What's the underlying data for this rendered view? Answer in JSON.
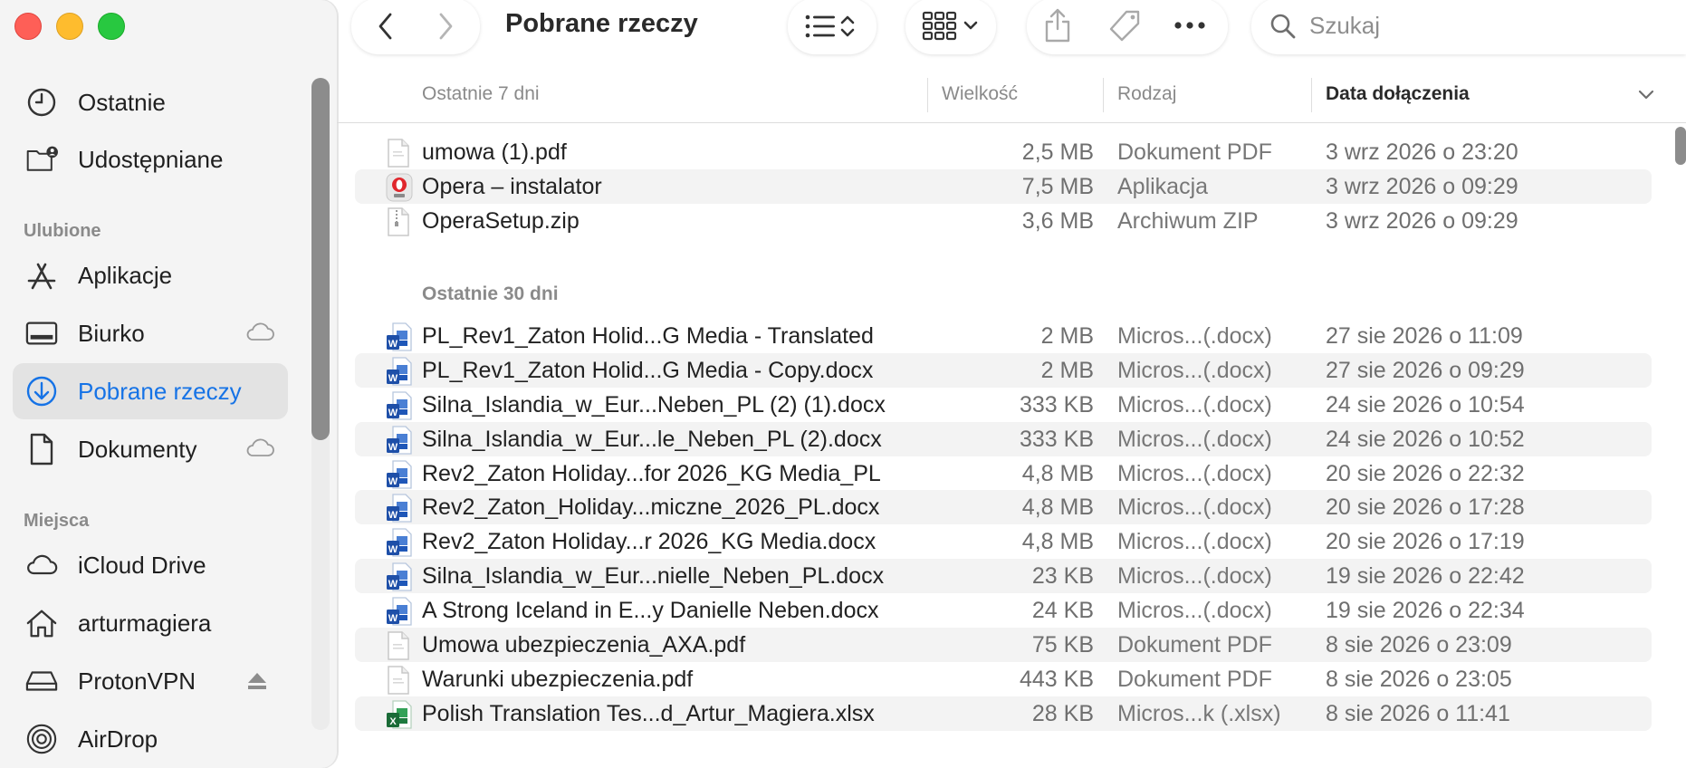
{
  "window": {
    "title": "Pobrane rzeczy"
  },
  "toolbar": {
    "search_placeholder": "Szukaj",
    "icons": [
      "chevron-left-icon",
      "chevron-right-icon",
      "list-view-icon",
      "grid-view-icon",
      "share-icon",
      "tag-icon",
      "more-icon",
      "search-icon"
    ]
  },
  "sidebar": {
    "top_items": [
      {
        "label": "Ostatnie",
        "icon": "clock-icon"
      },
      {
        "label": "Udostępniane",
        "icon": "shared-folder-icon"
      }
    ],
    "favorites_header": "Ulubione",
    "favorites": [
      {
        "label": "Aplikacje",
        "icon": "apps-icon"
      },
      {
        "label": "Biurko",
        "icon": "desktop-icon",
        "cloud": true
      },
      {
        "label": "Pobrane rzeczy",
        "icon": "download-icon",
        "active": true
      },
      {
        "label": "Dokumenty",
        "icon": "document-icon",
        "cloud": true
      }
    ],
    "places_header": "Miejsca",
    "places": [
      {
        "label": "iCloud Drive",
        "icon": "cloud-icon"
      },
      {
        "label": "arturmagiera",
        "icon": "home-icon"
      },
      {
        "label": "ProtonVPN",
        "icon": "drive-icon",
        "eject": true
      },
      {
        "label": "AirDrop",
        "icon": "airdrop-icon"
      }
    ]
  },
  "columns": {
    "name": "Ostatnie 7 dni",
    "size": "Wielkość",
    "kind": "Rodzaj",
    "date": "Data dołączenia"
  },
  "sections": [
    {
      "label": "Ostatnie 7 dni",
      "rows": [
        {
          "name": "umowa (1).pdf",
          "size": "2,5 MB",
          "kind": "Dokument PDF",
          "date": "3 wrz 2026 o 23:20",
          "icon": "pdf"
        },
        {
          "name": "Opera – instalator",
          "size": "7,5 MB",
          "kind": "Aplikacja",
          "date": "3 wrz 2026 o 09:29",
          "icon": "app"
        },
        {
          "name": "OperaSetup.zip",
          "size": "3,6 MB",
          "kind": "Archiwum ZIP",
          "date": "3 wrz 2026 o 09:29",
          "icon": "zip"
        }
      ]
    },
    {
      "label": "Ostatnie 30 dni",
      "rows": [
        {
          "name": "PL_Rev1_Zaton Holid...G Media - Translated",
          "size": "2 MB",
          "kind": "Micros...(.docx)",
          "date": "27 sie 2026 o 11:09",
          "icon": "word"
        },
        {
          "name": "PL_Rev1_Zaton Holid...G Media - Copy.docx",
          "size": "2 MB",
          "kind": "Micros...(.docx)",
          "date": "27 sie 2026 o 09:29",
          "icon": "word"
        },
        {
          "name": "Silna_Islandia_w_Eur...Neben_PL (2) (1).docx",
          "size": "333 KB",
          "kind": "Micros...(.docx)",
          "date": "24 sie 2026 o 10:54",
          "icon": "word"
        },
        {
          "name": "Silna_Islandia_w_Eur...le_Neben_PL (2).docx",
          "size": "333 KB",
          "kind": "Micros...(.docx)",
          "date": "24 sie 2026 o 10:52",
          "icon": "word"
        },
        {
          "name": "Rev2_Zaton Holiday...for 2026_KG Media_PL",
          "size": "4,8 MB",
          "kind": "Micros...(.docx)",
          "date": "20 sie 2026 o 22:32",
          "icon": "word"
        },
        {
          "name": "Rev2_Zaton_Holiday...miczne_2026_PL.docx",
          "size": "4,8 MB",
          "kind": "Micros...(.docx)",
          "date": "20 sie 2026 o 17:28",
          "icon": "word"
        },
        {
          "name": "Rev2_Zaton Holiday...r 2026_KG Media.docx",
          "size": "4,8 MB",
          "kind": "Micros...(.docx)",
          "date": "20 sie 2026 o 17:19",
          "icon": "word"
        },
        {
          "name": "Silna_Islandia_w_Eur...nielle_Neben_PL.docx",
          "size": "23 KB",
          "kind": "Micros...(.docx)",
          "date": "19 sie 2026 o 22:42",
          "icon": "word"
        },
        {
          "name": "A Strong Iceland in E...y Danielle Neben.docx",
          "size": "24 KB",
          "kind": "Micros...(.docx)",
          "date": "19 sie 2026 o 22:34",
          "icon": "word"
        },
        {
          "name": "Umowa ubezpieczenia_AXA.pdf",
          "size": "75 KB",
          "kind": "Dokument PDF",
          "date": "8 sie 2026 o 23:09",
          "icon": "pdf"
        },
        {
          "name": "Warunki ubezpieczenia.pdf",
          "size": "443 KB",
          "kind": "Dokument PDF",
          "date": "8 sie 2026 o 23:05",
          "icon": "pdf"
        },
        {
          "name": "Polish Translation Tes...d_Artur_Magiera.xlsx",
          "size": "28 KB",
          "kind": "Micros...k (.xlsx)",
          "date": "8 sie 2026 o 11:41",
          "icon": "excel"
        }
      ]
    }
  ]
}
